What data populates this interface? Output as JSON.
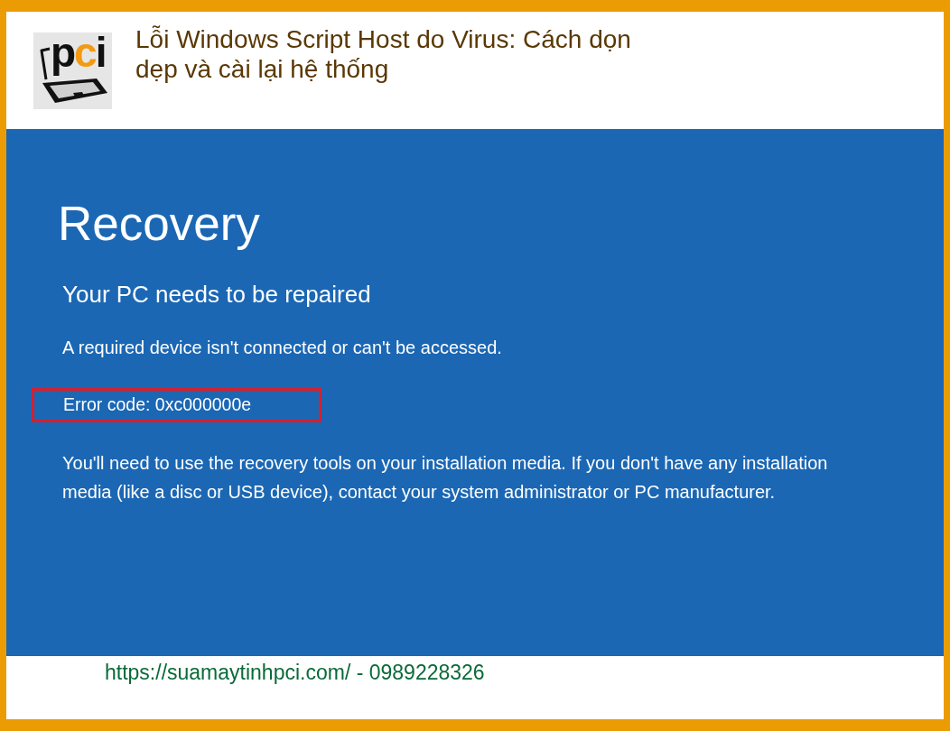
{
  "header": {
    "logo": {
      "text": "pci"
    },
    "title": "Lỗi Windows Script Host do Virus: Cách dọn dẹp và cài lại hệ thống"
  },
  "recovery_screen": {
    "title": "Recovery",
    "heading": "Your PC needs to be repaired",
    "message": "A required device isn't connected or can't be accessed.",
    "error_code": {
      "text": "Error code: 0xc000000e",
      "highlighted": true
    },
    "instructions": "You'll need to use the recovery tools on your installation media. If you don't have any installation media (like a disc or USB device), contact your system administrator or PC manufacturer."
  },
  "footer": {
    "text": "https://suamaytinhpci.com/ - 0989228326"
  }
}
